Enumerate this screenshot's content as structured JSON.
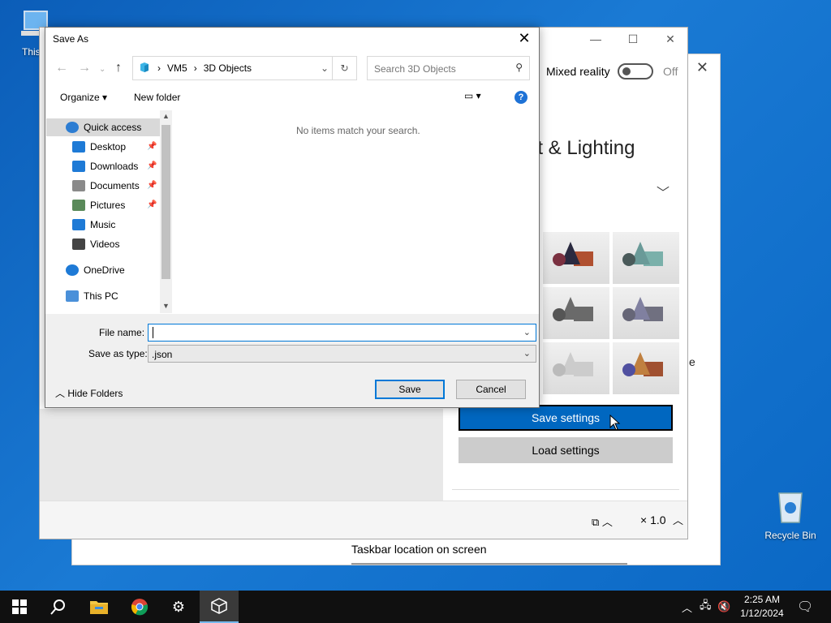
{
  "desktop": {
    "this_pc_label": "This P",
    "recycle_bin_label": "Recycle Bin"
  },
  "settings_window": {
    "taskbar_location_label": "Taskbar location on screen"
  },
  "viewer_window": {
    "mixed_reality_label": "Mixed reality",
    "mixed_reality_state": "Off",
    "section_title": "nt & Lighting",
    "save_settings_label": "Save settings",
    "load_settings_label": "Load settings",
    "zoom_label": "× 1.0",
    "partial_letter": "e",
    "presets": [
      {
        "c1": "#2a2a40",
        "c2": "#7a3040",
        "c3": "#b05030"
      },
      {
        "c1": "#6a9a98",
        "c2": "#4a5a5a",
        "c3": "#7ab0aa"
      },
      {
        "c1": "#6a6a6a",
        "c2": "#555555",
        "c3": "#6a6a6a"
      },
      {
        "c1": "#8080a0",
        "c2": "#666677",
        "c3": "#707080"
      },
      {
        "c1": "#cccccc",
        "c2": "#bbbbbb",
        "c3": "#cccccc"
      },
      {
        "c1": "#c08040",
        "c2": "#5050a0",
        "c3": "#a05030"
      }
    ]
  },
  "dialog": {
    "title": "Save As",
    "breadcrumb": [
      "VM5",
      "3D Objects"
    ],
    "search_placeholder": "Search 3D Objects",
    "organize_label": "Organize ▾",
    "new_folder_label": "New folder",
    "nav_items": [
      {
        "label": "Quick access",
        "icon": "star-icon",
        "color": "#2d7dd2",
        "pinned": false,
        "selected": true
      },
      {
        "label": "Desktop",
        "icon": "desktop-folder-icon",
        "color": "#1e7ad6",
        "pinned": true,
        "selected": false
      },
      {
        "label": "Downloads",
        "icon": "downloads-folder-icon",
        "color": "#1e7ad6",
        "pinned": true,
        "selected": false
      },
      {
        "label": "Documents",
        "icon": "documents-folder-icon",
        "color": "#8a8a8a",
        "pinned": true,
        "selected": false
      },
      {
        "label": "Pictures",
        "icon": "pictures-folder-icon",
        "color": "#5a8a5a",
        "pinned": true,
        "selected": false
      },
      {
        "label": "Music",
        "icon": "music-folder-icon",
        "color": "#1e7ad6",
        "pinned": false,
        "selected": false
      },
      {
        "label": "Videos",
        "icon": "videos-folder-icon",
        "color": "#444444",
        "pinned": false,
        "selected": false
      },
      {
        "label": "OneDrive",
        "icon": "onedrive-icon",
        "color": "#1e7ad6",
        "pinned": false,
        "selected": false
      },
      {
        "label": "This PC",
        "icon": "this-pc-icon",
        "color": "#4a90d9",
        "pinned": false,
        "selected": false
      }
    ],
    "empty_message": "No items match your search.",
    "file_name_label": "File name:",
    "file_name_value": "",
    "save_as_type_label": "Save as type:",
    "save_as_type_value": ".json",
    "hide_folders_label": "Hide Folders",
    "save_button_label": "Save",
    "cancel_button_label": "Cancel"
  },
  "taskbar": {
    "clock_time": "2:25 AM",
    "clock_date": "1/12/2024"
  }
}
